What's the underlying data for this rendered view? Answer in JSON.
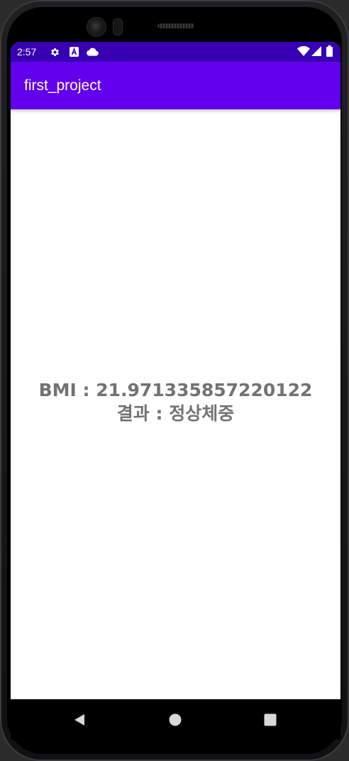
{
  "status_bar": {
    "time": "2:57",
    "icons": [
      "gear-icon",
      "a-box-icon",
      "cloud-icon",
      "wifi-icon",
      "signal-icon",
      "battery-icon"
    ]
  },
  "app_bar": {
    "title": "first_project",
    "color": "#6200ee",
    "status_color": "#3700b3"
  },
  "result": {
    "bmi_line": "BMI :  21.971335857220122",
    "result_line": "결과 :  정상체중",
    "text_color": "#727272"
  },
  "nav_bar": {
    "icons": [
      "back-icon",
      "home-icon",
      "recents-icon"
    ]
  }
}
